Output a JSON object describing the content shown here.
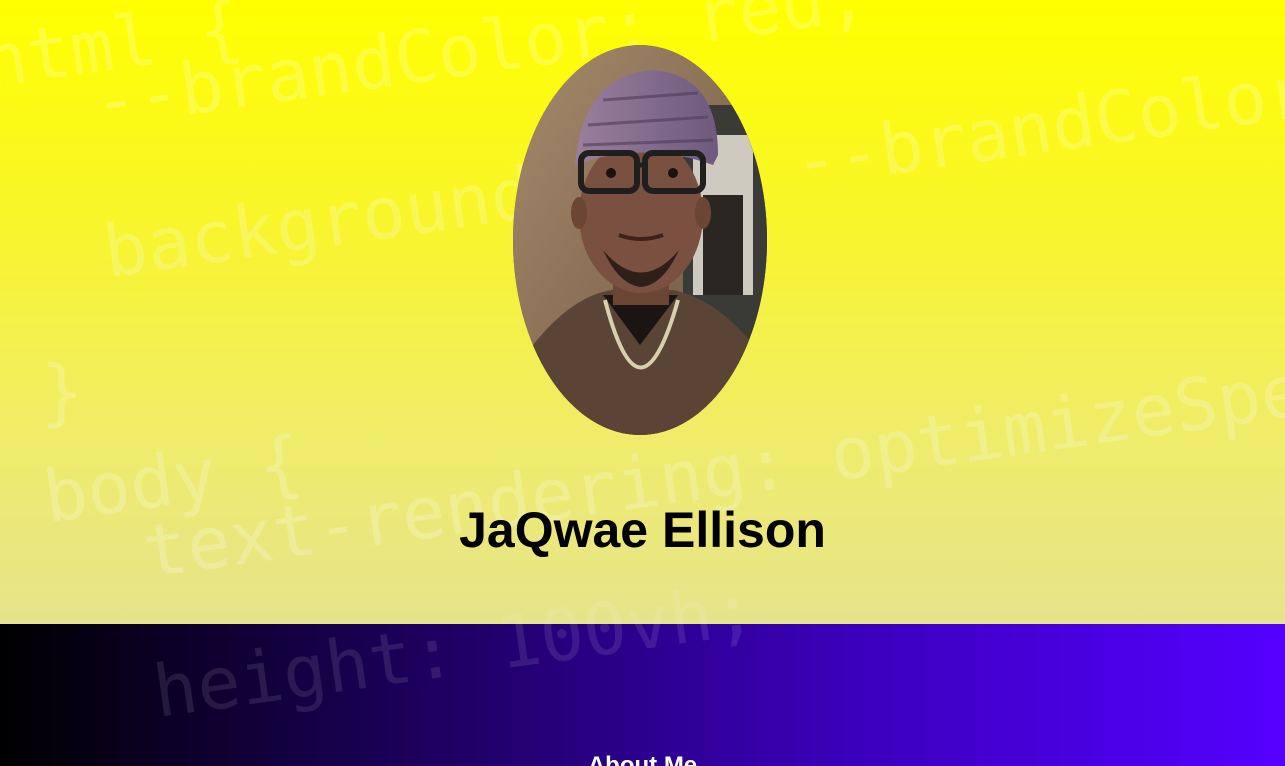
{
  "profile": {
    "name": "JaQwae Ellison",
    "photo_icon": "profile-photo"
  },
  "about": {
    "title": "About Me"
  },
  "code_watermark": {
    "lines": [
      "html {",
      "--brandColor: red;",
      "--brandColor",
      "background",
      "}",
      "body {",
      "text-rendering: optimizeSpeed;",
      "height: 100vh;"
    ]
  },
  "colors": {
    "hero_top": "#ffff00",
    "hero_bottom": "#e6e48c",
    "about_left": "#000000",
    "about_right": "#5500ff",
    "name_text": "#000000",
    "about_text": "#ffffff"
  }
}
